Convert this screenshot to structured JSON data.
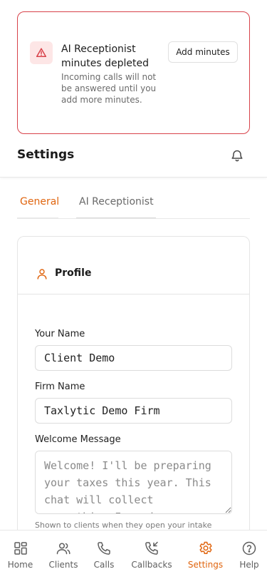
{
  "alert": {
    "title": "AI Receptionist minutes depleted",
    "body": "Incoming calls will not be answered until you add more minutes.",
    "button_label": "Add minutes",
    "icon": "warning-triangle-icon",
    "border_color": "#d8424a"
  },
  "header": {
    "title": "Settings",
    "icon": "bell-icon"
  },
  "tabs": [
    {
      "label": "General",
      "active": true
    },
    {
      "label": "AI Receptionist",
      "active": false
    }
  ],
  "profile": {
    "title": "Profile",
    "icon": "user-icon",
    "fields": {
      "your_name": {
        "label": "Your Name",
        "value": "Client Demo"
      },
      "firm_name": {
        "label": "Firm Name",
        "value": "Taxlytic Demo Firm"
      },
      "welcome_message": {
        "label": "Welcome Message",
        "placeholder": "Welcome! I'll be preparing your taxes this year. This chat will collect everything I need."
      }
    },
    "helper_text": "Shown to clients when they open your intake"
  },
  "nav": [
    {
      "label": "Home",
      "icon": "grid-icon",
      "active": false
    },
    {
      "label": "Clients",
      "icon": "users-icon",
      "active": false
    },
    {
      "label": "Calls",
      "icon": "phone-icon",
      "active": false
    },
    {
      "label": "Callbacks",
      "icon": "phone-callback-icon",
      "active": false
    },
    {
      "label": "Settings",
      "icon": "gear-icon",
      "active": true
    },
    {
      "label": "Help",
      "icon": "help-icon",
      "active": false
    }
  ],
  "colors": {
    "accent": "#e0650f",
    "danger": "#d8424a"
  }
}
